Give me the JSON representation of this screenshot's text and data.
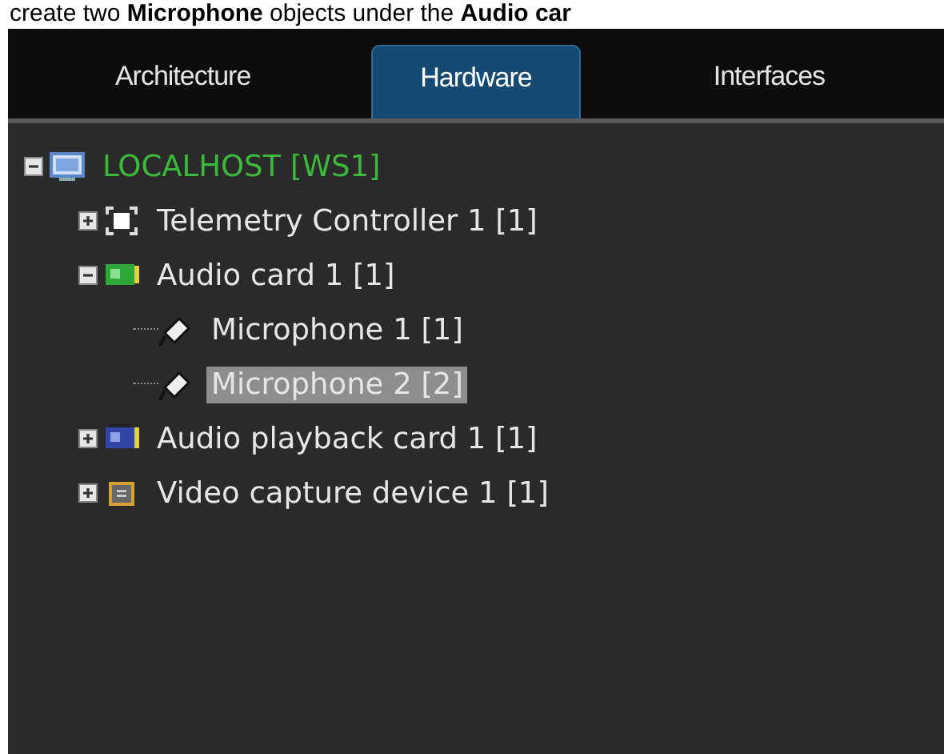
{
  "caption": "create two **Microphone** objects under the **Audio car**",
  "tabs": [
    {
      "label": "Architecture",
      "selected": false
    },
    {
      "label": "Hardware",
      "selected": true
    },
    {
      "label": "Interfaces",
      "selected": false
    }
  ],
  "tree": [
    {
      "label": "LOCALHOST [WS1]",
      "kind": "computer",
      "expanded": true,
      "selected": false,
      "children": [
        {
          "label": "Telemetry Controller 1 [1]",
          "kind": "telemetry",
          "expanded": false,
          "selected": false
        },
        {
          "label": "Audio card 1 [1]",
          "kind": "audio-card",
          "expanded": true,
          "selected": false,
          "children": [
            {
              "label": "Microphone 1 [1]",
              "kind": "microphone",
              "selected": false
            },
            {
              "label": "Microphone 2 [2]",
              "kind": "microphone",
              "selected": true
            }
          ]
        },
        {
          "label": "Audio playback card 1 [1]",
          "kind": "playback-card",
          "expanded": false,
          "selected": false
        },
        {
          "label": "Video capture device 1 [1]",
          "kind": "capture-chip",
          "expanded": false,
          "selected": false
        }
      ]
    }
  ]
}
